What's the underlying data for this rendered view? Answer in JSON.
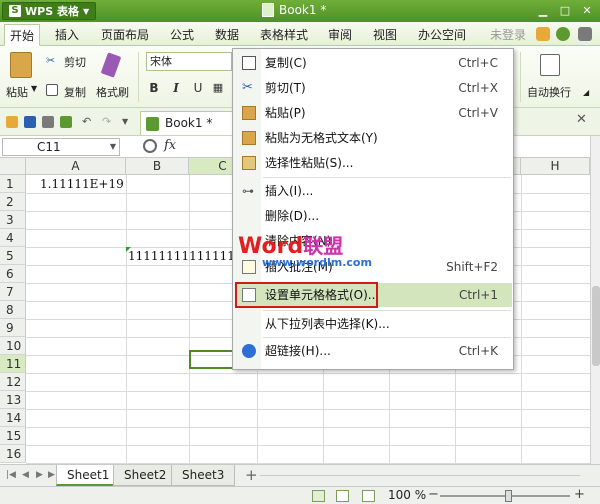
{
  "titlebar": {
    "app_name": "WPS 表格",
    "app_logo": "S",
    "document_title": "Book1 *"
  },
  "menubar": {
    "tabs": [
      "开始",
      "插入",
      "页面布局",
      "公式",
      "数据",
      "表格样式",
      "审阅",
      "视图",
      "办公空间"
    ],
    "login": "未登录"
  },
  "ribbon": {
    "paste": "粘贴",
    "cut": "剪切",
    "copy": "复制",
    "format_painter": "格式刷",
    "font_name": "宋体",
    "bold": "B",
    "italic": "I",
    "wrap_text": "自动换行"
  },
  "quickbar": {
    "doc_tab": "Book1 *"
  },
  "formula_bar": {
    "name_box": "C11",
    "fx_label": "fx"
  },
  "grid": {
    "columns": [
      "A",
      "B",
      "C",
      "D",
      "E",
      "F",
      "G",
      "H"
    ],
    "rows": [
      "1",
      "2",
      "3",
      "4",
      "5",
      "6",
      "7",
      "8",
      "9",
      "10",
      "11",
      "12",
      "13",
      "14",
      "15",
      "16"
    ],
    "selected_column": "C",
    "selected_row": "11",
    "cell_A1": "1.11111E+19",
    "cell_B5": "11111111111111111111"
  },
  "context_menu": {
    "items": [
      {
        "label": "复制(C)",
        "shortcut": "Ctrl+C",
        "icon": "copy-icon"
      },
      {
        "label": "剪切(T)",
        "shortcut": "Ctrl+X",
        "icon": "scissors-icon"
      },
      {
        "label": "粘贴(P)",
        "shortcut": "Ctrl+V",
        "icon": "paste-icon"
      },
      {
        "label": "粘贴为无格式文本(Y)",
        "shortcut": "",
        "icon": "paste-text-icon"
      },
      {
        "label": "选择性粘贴(S)...",
        "shortcut": "",
        "icon": "paste-special-icon"
      },
      {
        "label": "插入(I)...",
        "shortcut": "",
        "icon": "insert-icon"
      },
      {
        "label": "删除(D)...",
        "shortcut": "",
        "icon": ""
      },
      {
        "label": "清除内容(N)",
        "shortcut": "",
        "icon": ""
      },
      {
        "label": "插入批注(M)",
        "shortcut": "Shift+F2",
        "icon": "comment-icon"
      },
      {
        "label": "设置单元格格式(O)...",
        "shortcut": "Ctrl+1",
        "icon": "format-cells-icon"
      },
      {
        "label": "从下拉列表中选择(K)...",
        "shortcut": "",
        "icon": ""
      },
      {
        "label": "超链接(H)...",
        "shortcut": "Ctrl+K",
        "icon": "hyperlink-icon"
      }
    ]
  },
  "watermark": {
    "brand_a": "Word",
    "brand_b": "联盟",
    "url": "www.wordlm.com"
  },
  "sheets": {
    "tabs": [
      "Sheet1",
      "Sheet2",
      "Sheet3"
    ],
    "active": "Sheet1",
    "add": "+"
  },
  "statusbar": {
    "zoom": "100 %",
    "zoom_minus": "−",
    "zoom_plus": "+"
  },
  "colors": {
    "accent": "#5c9a31",
    "highlight": "#d2e5bd",
    "red_box": "#d21a1a"
  }
}
